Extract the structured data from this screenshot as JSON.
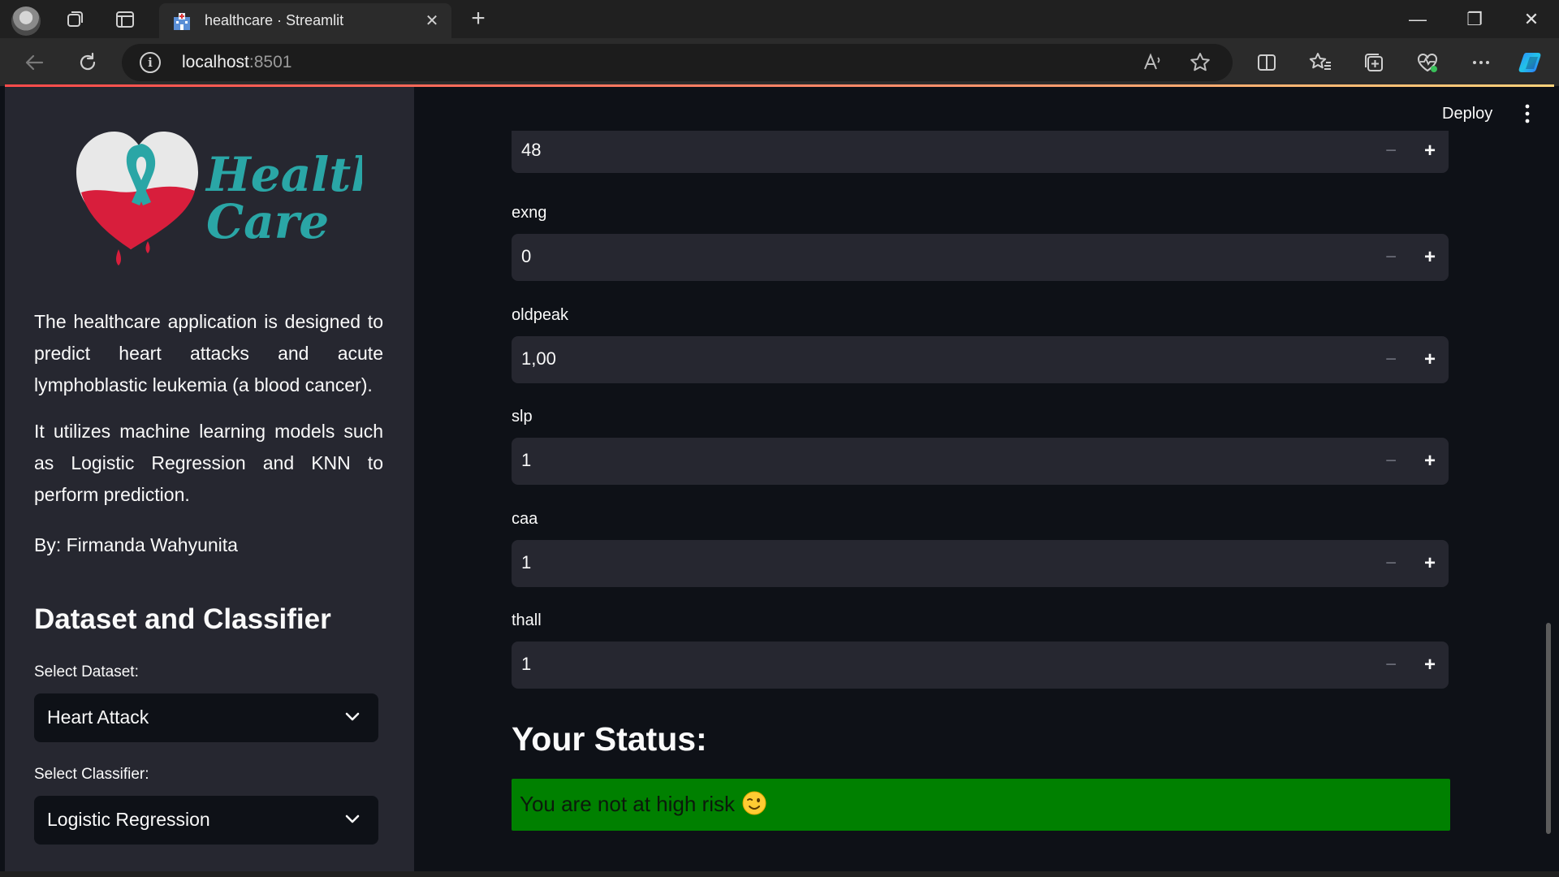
{
  "browser": {
    "tab_title": "healthcare · Streamlit",
    "tab_close": "✕",
    "new_tab": "+",
    "url_host": "localhost",
    "url_port": ":8501",
    "window_controls": {
      "minimize": "—",
      "restore": "❐",
      "close": "✕"
    }
  },
  "header": {
    "deploy_label": "Deploy"
  },
  "sidebar": {
    "logo_text_line1": "Health",
    "logo_text_line2": "Care",
    "description_1": "The healthcare application is designed to predict heart attacks and acute lymphoblastic leukemia (a blood cancer).",
    "description_2": "It utilizes machine learning models such as Logistic Regression and KNN to perform prediction.",
    "author": "By: Firmanda Wahyunita",
    "section_title": "Dataset and Classifier",
    "dataset_label": "Select Dataset:",
    "dataset_value": "Heart Attack",
    "classifier_label": "Select Classifier:",
    "classifier_value": "Logistic Regression"
  },
  "main": {
    "fields": [
      {
        "label": "",
        "value": "48"
      },
      {
        "label": "exng",
        "value": "0"
      },
      {
        "label": "oldpeak",
        "value": "1,00"
      },
      {
        "label": "slp",
        "value": "1"
      },
      {
        "label": "caa",
        "value": "1"
      },
      {
        "label": "thall",
        "value": "1"
      }
    ],
    "stepper_minus": "−",
    "stepper_plus": "+",
    "status_heading": "Your Status:",
    "status_message": "You are not at high risk",
    "status_color": "#008000"
  },
  "colors": {
    "sidebar_bg": "#262730",
    "main_bg": "#0e1117",
    "accent": "#ff4b4b",
    "logo_teal": "#2aa6a6",
    "logo_red": "#d81e3c"
  }
}
